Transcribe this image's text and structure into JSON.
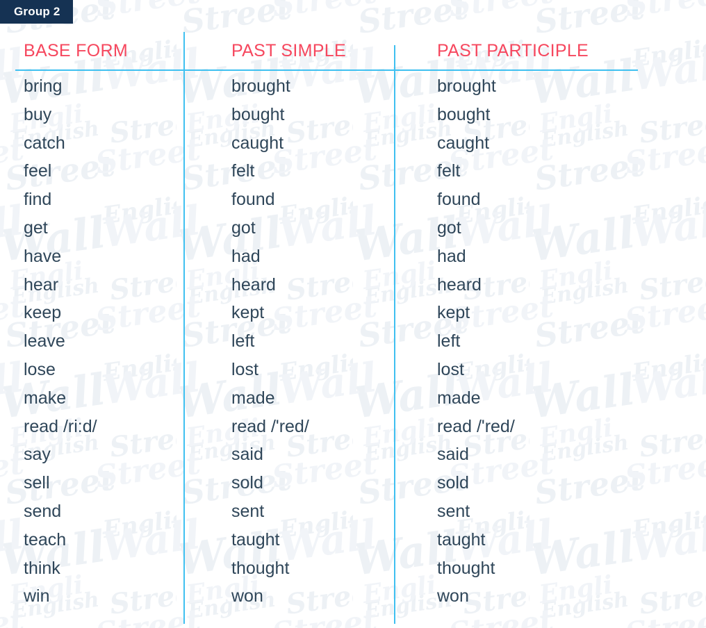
{
  "badge": {
    "label": "Group 2"
  },
  "colors": {
    "badge_background": "#153253",
    "badge_text": "#FFFFFF",
    "header_text": "#F6475E",
    "rule": "#3FC0F0",
    "body_text": "#2F4659",
    "page_background": "#FFFFFF",
    "watermark": "#EEF2F6"
  },
  "watermark": {
    "words": [
      "Wall",
      "Street",
      "English"
    ]
  },
  "table": {
    "headers": [
      "BASE FORM",
      "PAST SIMPLE",
      "PAST PARTICIPLE"
    ],
    "rows": [
      {
        "base": "bring",
        "past_simple": "brought",
        "past_participle": "brought"
      },
      {
        "base": "buy",
        "past_simple": "bought",
        "past_participle": "bought"
      },
      {
        "base": "catch",
        "past_simple": "caught",
        "past_participle": "caught"
      },
      {
        "base": "feel",
        "past_simple": "felt",
        "past_participle": "felt"
      },
      {
        "base": "find",
        "past_simple": "found",
        "past_participle": "found"
      },
      {
        "base": "get",
        "past_simple": "got",
        "past_participle": "got"
      },
      {
        "base": "have",
        "past_simple": "had",
        "past_participle": "had"
      },
      {
        "base": "hear",
        "past_simple": "heard",
        "past_participle": "heard"
      },
      {
        "base": "keep",
        "past_simple": "kept",
        "past_participle": "kept"
      },
      {
        "base": "leave",
        "past_simple": "left",
        "past_participle": "left"
      },
      {
        "base": "lose",
        "past_simple": "lost",
        "past_participle": "lost"
      },
      {
        "base": "make",
        "past_simple": "made",
        "past_participle": "made"
      },
      {
        "base": "read /ri:d/",
        "past_simple": "read /'red/",
        "past_participle": "read /'red/"
      },
      {
        "base": "say",
        "past_simple": "said",
        "past_participle": "said"
      },
      {
        "base": "sell",
        "past_simple": "sold",
        "past_participle": "sold"
      },
      {
        "base": "send",
        "past_simple": "sent",
        "past_participle": "sent"
      },
      {
        "base": "teach",
        "past_simple": "taught",
        "past_participle": "taught"
      },
      {
        "base": "think",
        "past_simple": "thought",
        "past_participle": "thought"
      },
      {
        "base": "win",
        "past_simple": "won",
        "past_participle": "won"
      }
    ]
  }
}
